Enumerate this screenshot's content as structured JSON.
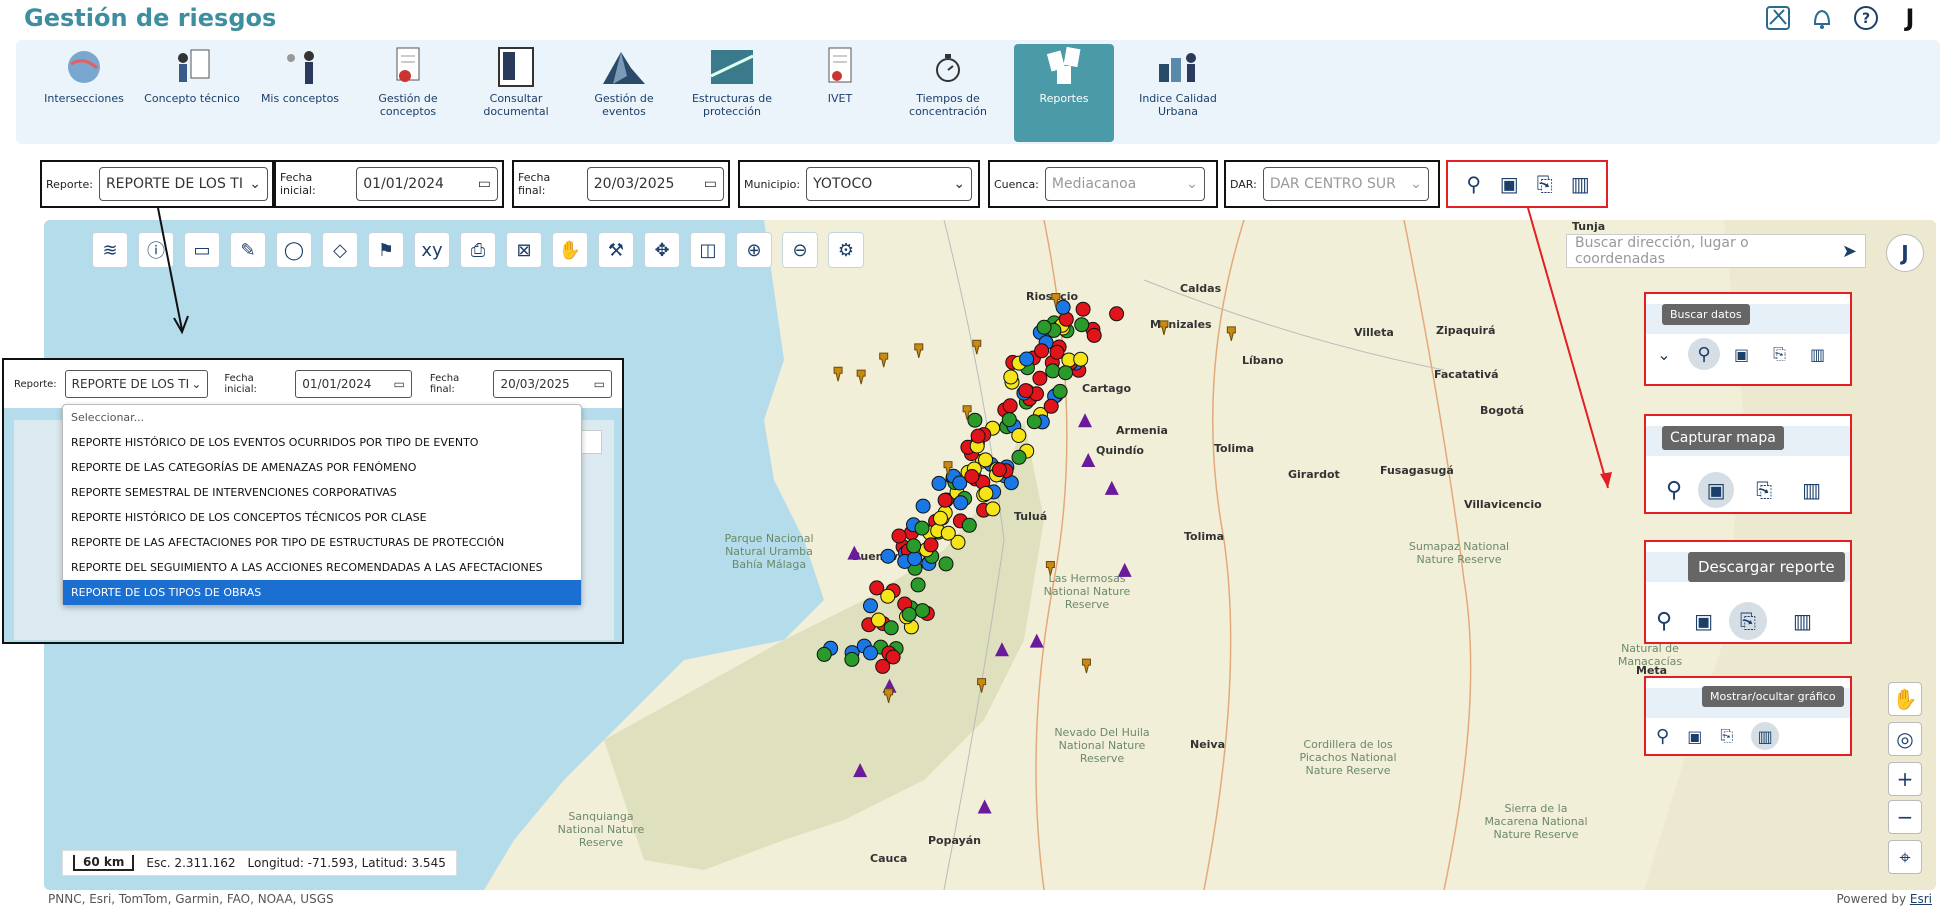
{
  "app": {
    "title": "Gestión de riesgos",
    "user_initial": "J"
  },
  "header_icons": [
    "map-pin-icon",
    "bell-icon",
    "help-icon",
    "user-initial"
  ],
  "modules": [
    {
      "label": "Intersecciones",
      "icon": "globe-icon"
    },
    {
      "label": "Concepto técnico",
      "icon": "person-board-icon"
    },
    {
      "label": "Mis conceptos",
      "icon": "people-icon"
    },
    {
      "label": "Gestión de conceptos",
      "icon": "document-icon"
    },
    {
      "label": "Consultar documental",
      "icon": "book-icon"
    },
    {
      "label": "Gestión de eventos",
      "icon": "landslide-icon"
    },
    {
      "label": "Estructuras de protección",
      "icon": "wall-icon"
    },
    {
      "label": "IVET",
      "icon": "report-icon"
    },
    {
      "label": "Tiempos de concentración",
      "icon": "stopwatch-icon"
    },
    {
      "label": "Reportes",
      "icon": "papers-icon",
      "active": true
    },
    {
      "label": "Indice Calidad Urbana",
      "icon": "city-person-icon"
    }
  ],
  "filters": {
    "reporte_label": "Reporte:",
    "reporte_value": "REPORTE DE LOS TI",
    "fecha_inicial_label": "Fecha inicial:",
    "fecha_inicial_value": "01/01/2024",
    "fecha_final_label": "Fecha final:",
    "fecha_final_value": "20/03/2025",
    "municipio_label": "Municipio:",
    "municipio_value": "YOTOCO",
    "cuenca_label": "Cuenca:",
    "cuenca_value": "Mediacanoa",
    "dar_label": "DAR:",
    "dar_value": "DAR CENTRO SUR"
  },
  "map": {
    "search_placeholder": "Buscar dirección, lugar o coordenadas",
    "user_initial": "J",
    "scale_km": "60 km",
    "scale_esc": "Esc. 2.311.162",
    "coords": "Longitud: -71.593, Latitud: 3.545",
    "attribution": "PNNC, Esri, TomTom, Garmin, FAO, NOAA, USGS",
    "powered_by": "Powered by",
    "powered_link": "Esri",
    "places": [
      "Tunja",
      "Riosucio",
      "Caldas",
      "Manizales",
      "Villeta",
      "Zipaquirá",
      "Líbano",
      "Facatativá",
      "Bogotá",
      "Cartago",
      "Armenia",
      "Tolima",
      "Quindío",
      "Girardot",
      "Fusagasugá",
      "Villavicencio",
      "Tuluá",
      "Buenaventura",
      "Neiva",
      "Popayán",
      "Cauca",
      "Meta",
      "Tolima"
    ],
    "parks": [
      "Parque Nacional Natural Uramba Bahía Málaga",
      "Las Hermosas National Nature Reserve",
      "Sumapaz National Nature Reserve",
      "Nevado Del Huila National Nature Reserve",
      "Cordillera de los Picachos National Nature Reserve",
      "Sanquianga National Nature Reserve",
      "Sierra de la Macarena National Nature Reserve",
      "Natural de Manacacías"
    ]
  },
  "tooltips": {
    "buscar": "Buscar datos",
    "capturar": "Capturar mapa",
    "descargar": "Descargar reporte",
    "grafico": "Mostrar/ocultar gráfico"
  },
  "dropdown": {
    "reporte_label": "Reporte:",
    "reporte_value": "REPORTE DE LOS TI",
    "fecha_inicial_label": "Fecha inicial:",
    "fecha_inicial_value": "01/01/2024",
    "fecha_final_label": "Fecha final:",
    "fecha_final_value": "20/03/2025",
    "placeholder": "Seleccionar...",
    "options": [
      "REPORTE HISTÓRICO DE LOS EVENTOS OCURRIDOS POR TIPO DE EVENTO",
      "REPORTE DE LAS CATEGORÍAS DE AMENAZAS POR FENÓMENO",
      "REPORTE SEMESTRAL DE INTERVENCIONES CORPORATIVAS",
      "REPORTE HISTÓRICO DE LOS CONCEPTOS TÉCNICOS POR CLASE",
      "REPORTE DE LAS AFECTACIONES POR TIPO DE ESTRUCTURAS DE PROTECCIÓN",
      "REPORTE DEL SEGUIMIENTO A LAS ACCIONES RECOMENDADAS A LAS AFECTACIONES",
      "REPORTE DE LOS TIPOS DE OBRAS"
    ],
    "selected_index": 6
  },
  "colors": {
    "accent": "#4a9aa8",
    "brand_text": "#3d8fa0",
    "highlight_box": "#e31e24",
    "marker_red": "#e0141a",
    "marker_blue": "#1a78e6",
    "marker_green": "#2a9a2a",
    "marker_yellow": "#f4e418",
    "marker_purple": "#6a1a9a",
    "selected_option": "#1a6fd0"
  }
}
